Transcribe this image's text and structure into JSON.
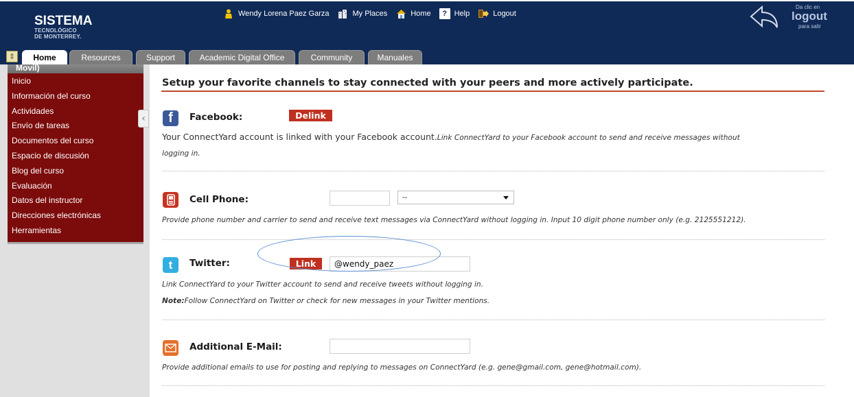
{
  "header": {
    "logo": {
      "line1": "SISTEMA",
      "line2": "TECNOLÓGICO",
      "line3": "DE MONTERREY."
    },
    "user_name": "Wendy Lorena Paez Garza",
    "nav": {
      "my_places": "My Places",
      "home": "Home",
      "help": "Help",
      "logout": "Logout"
    },
    "logout_box": {
      "line1": "Da clic en",
      "line2": "logout",
      "line3": "para salir"
    },
    "colors": {
      "background": "#0f2a57",
      "accent": "#c0301f"
    }
  },
  "tabs": [
    {
      "label": "Home",
      "active": true
    },
    {
      "label": "Resources",
      "active": false
    },
    {
      "label": "Support",
      "active": false
    },
    {
      "label": "Academic Digital Office",
      "active": false
    },
    {
      "label": "Community",
      "active": false
    },
    {
      "label": "Manuales",
      "active": false
    }
  ],
  "sidebar": {
    "header": "Movil)",
    "items": [
      {
        "label": "Inicio"
      },
      {
        "label": "Información del curso"
      },
      {
        "label": "Actividades"
      },
      {
        "label": "Envío de tareas"
      },
      {
        "label": "Documentos del curso"
      },
      {
        "label": "Espacio de discusión"
      },
      {
        "label": "Blog del curso"
      },
      {
        "label": "Evaluación"
      },
      {
        "label": "Datos del instructor"
      },
      {
        "label": "Direcciones electrónicas"
      },
      {
        "label": "Herramientas"
      }
    ]
  },
  "main": {
    "heading": "Setup your favorite channels to stay connected with your peers and more actively participate.",
    "facebook": {
      "label": "Facebook:",
      "button": "Delink",
      "status": "Your ConnectYard account is linked with your Facebook account.",
      "desc_line1": "Link ConnectYard to your Facebook account to send and receive messages without",
      "desc_line2": "logging in."
    },
    "cell_phone": {
      "label": "Cell Phone:",
      "phone_value": "",
      "carrier_selected": "--",
      "desc": "Provide phone number and carrier to send and receive text messages via ConnectYard without logging in. Input 10 digit phone number only (e.g. 2125551212)."
    },
    "twitter": {
      "label": "Twitter:",
      "button": "Link",
      "value": "@wendy_paez",
      "desc": "Link ConnectYard to your Twitter account to send and receive tweets without logging in.",
      "note_label": "Note:",
      "note_text": "Follow ConnectYard on Twitter or check for new messages in your Twitter mentions."
    },
    "email": {
      "label": "Additional E-Mail:",
      "value": "",
      "desc": "Provide additional emails to use for posting and replying to messages on ConnectYard (e.g. gene@gmail.com, gene@hotmail.com)."
    }
  }
}
